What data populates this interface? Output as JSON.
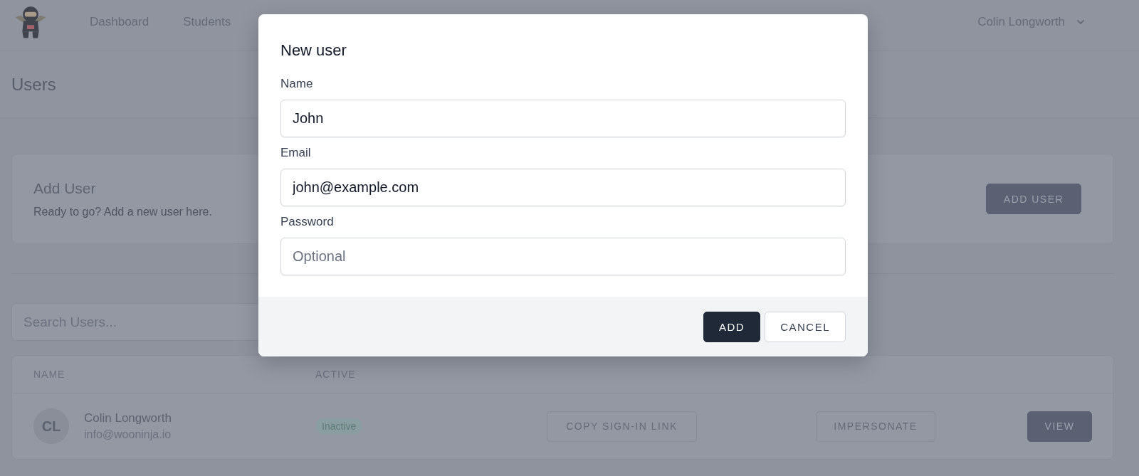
{
  "header": {
    "nav": [
      {
        "label": "Dashboard"
      },
      {
        "label": "Students"
      }
    ],
    "user_menu": {
      "label": "Colin Longworth"
    }
  },
  "page_title": "Users",
  "add_user_card": {
    "title": "Add User",
    "subtitle": "Ready to go? Add a new user here.",
    "button": "ADD USER"
  },
  "search": {
    "placeholder": "Search Users..."
  },
  "table": {
    "columns": [
      "NAME",
      "ACTIVE"
    ],
    "rows": [
      {
        "initials": "CL",
        "name": "Colin Longworth",
        "email": "info@wooninja.io",
        "status": "Inactive",
        "actions": [
          {
            "label": "COPY SIGN-IN LINK",
            "kind": "outline"
          },
          {
            "label": "IMPERSONATE",
            "kind": "outline"
          },
          {
            "label": "VIEW",
            "kind": "solid"
          }
        ]
      }
    ]
  },
  "modal": {
    "title": "New user",
    "fields": [
      {
        "label": "Name",
        "value": "John"
      },
      {
        "label": "Email",
        "value": "john@example.com"
      },
      {
        "label": "Password",
        "placeholder": "Optional"
      }
    ],
    "buttons": [
      {
        "label": "ADD",
        "kind": "primary"
      },
      {
        "label": "CANCEL",
        "kind": "secondary"
      }
    ]
  }
}
